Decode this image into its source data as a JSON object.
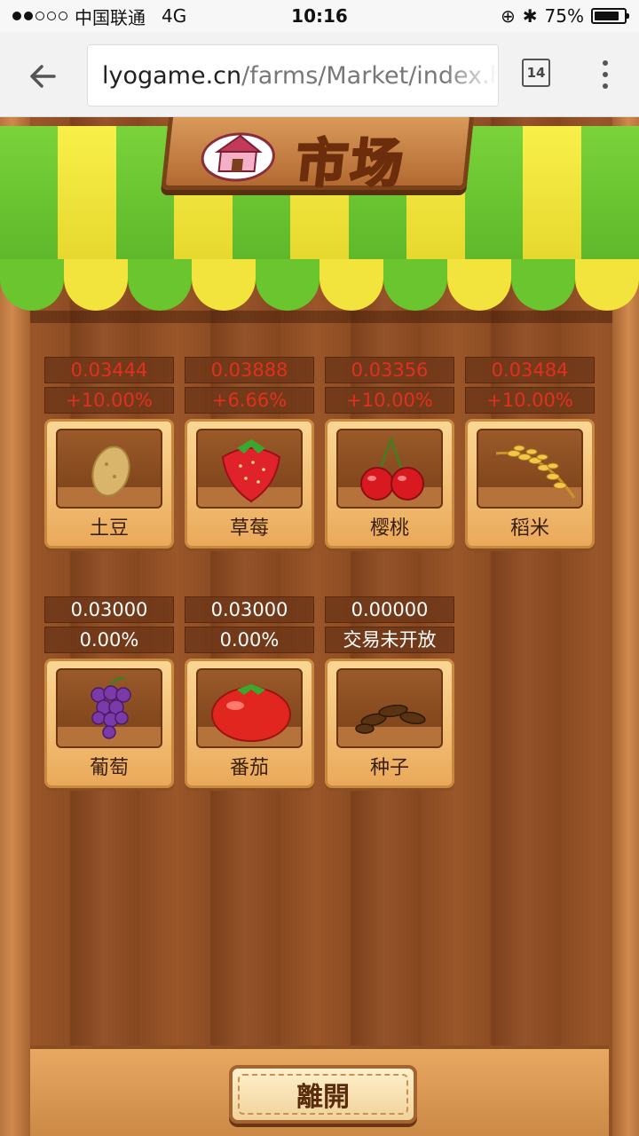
{
  "status": {
    "carrier": "中国联通",
    "network": "4G",
    "time": "10:16",
    "battery": "75%"
  },
  "browser": {
    "url_host": "lyogame.cn",
    "url_path": "/farms/Market/index.ht",
    "tab_count": "14"
  },
  "market": {
    "title": "市场",
    "leave_label": "離開",
    "items": [
      {
        "name": "土豆",
        "price": "0.03444",
        "change": "+10.00%",
        "icon": "potato-icon"
      },
      {
        "name": "草莓",
        "price": "0.03888",
        "change": "+6.66%",
        "icon": "strawberry-icon"
      },
      {
        "name": "樱桃",
        "price": "0.03356",
        "change": "+10.00%",
        "icon": "cherry-icon"
      },
      {
        "name": "稻米",
        "price": "0.03484",
        "change": "+10.00%",
        "icon": "rice-icon"
      },
      {
        "name": "葡萄",
        "price": "0.03000",
        "change": "0.00%",
        "icon": "grape-icon"
      },
      {
        "name": "番茄",
        "price": "0.03000",
        "change": "0.00%",
        "icon": "tomato-icon"
      },
      {
        "name": "种子",
        "price": "0.00000",
        "change": "交易未开放",
        "icon": "seed-icon"
      }
    ]
  },
  "colors": {
    "price_up": "#e03020",
    "price_flat": "#ffffff",
    "awning_green": "#6ac52e",
    "awning_yellow": "#f2e43c"
  }
}
